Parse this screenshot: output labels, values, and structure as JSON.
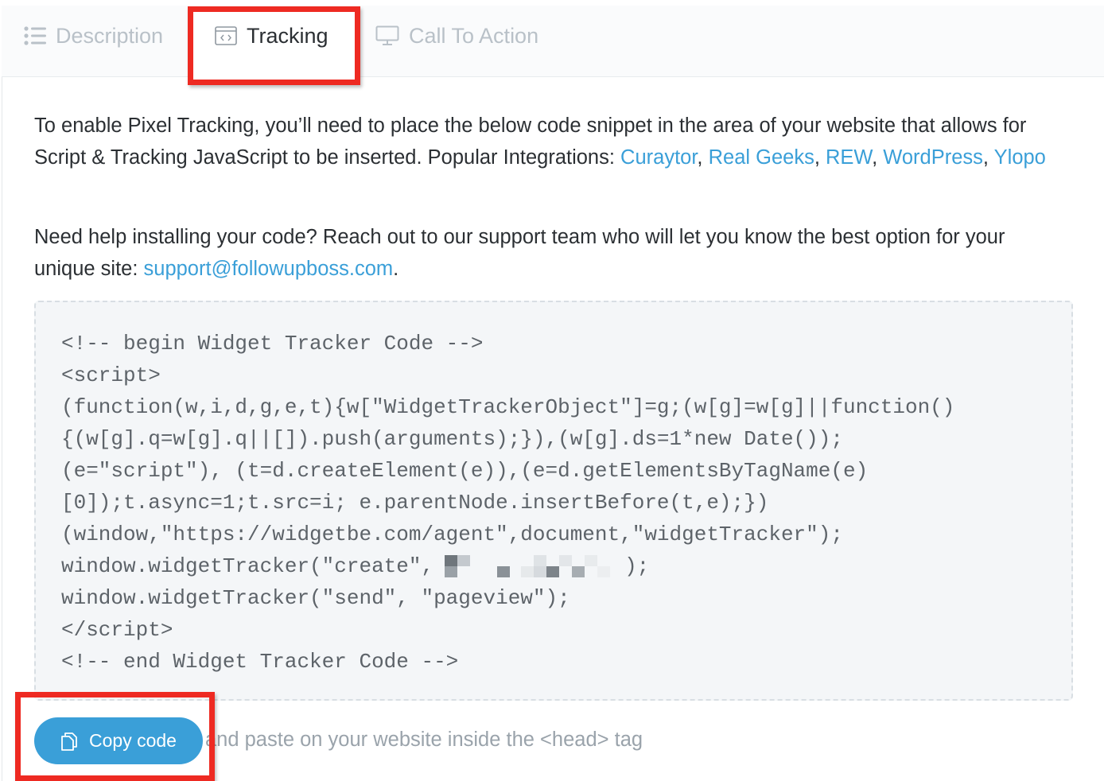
{
  "tabs": [
    {
      "label": "Description",
      "icon": "list-icon",
      "active": false
    },
    {
      "label": "Tracking",
      "icon": "code-window-icon",
      "active": true
    },
    {
      "label": "Call To Action",
      "icon": "monitor-icon",
      "active": false
    }
  ],
  "intro": {
    "text": "To enable Pixel Tracking, you’ll need to place the below code snippet in the area of your website that allows for Script & Tracking JavaScript to be inserted. Popular Integrations: ",
    "links": [
      "Curaytor",
      "Real Geeks",
      "REW",
      "WordPress",
      "Ylopo"
    ]
  },
  "help": {
    "text": "Need help installing your code? Reach out to our support team who will let you know the best option for your unique site: ",
    "email": "support@followupboss.com",
    "period": "."
  },
  "code_lines": [
    "<!-- begin Widget Tracker Code -->",
    "<script>",
    "(function(w,i,d,g,e,t){w[\"WidgetTrackerObject\"]=g;(w[g]=w[g]||function()",
    "{(w[g].q=w[g].q||[]).push(arguments);}),(w[g].ds=1*new Date());",
    "(e=\"script\"), (t=d.createElement(e)),(e=d.getElementsByTagName(e)",
    "[0]);t.async=1;t.src=i; e.parentNode.insertBefore(t,e);})",
    "(window,\"https://widgetbe.com/agent\",document,\"widgetTracker\");",
    "window.widgetTracker(\"create\",",
    "window.widgetTracker(\"send\", \"pageview\");",
    "</scr",
    "<!-- end Widget Tracker Code -->"
  ],
  "code_create_suffix": ");",
  "code_close_script_tail": "ipt>",
  "copy_button": {
    "label": "Copy code",
    "icon": "copy-icon"
  },
  "hint": "and paste on your website inside the <head> tag",
  "colors": {
    "link": "#3a9fd8",
    "highlight": "#ee2a22",
    "button": "#3a9fd8"
  }
}
